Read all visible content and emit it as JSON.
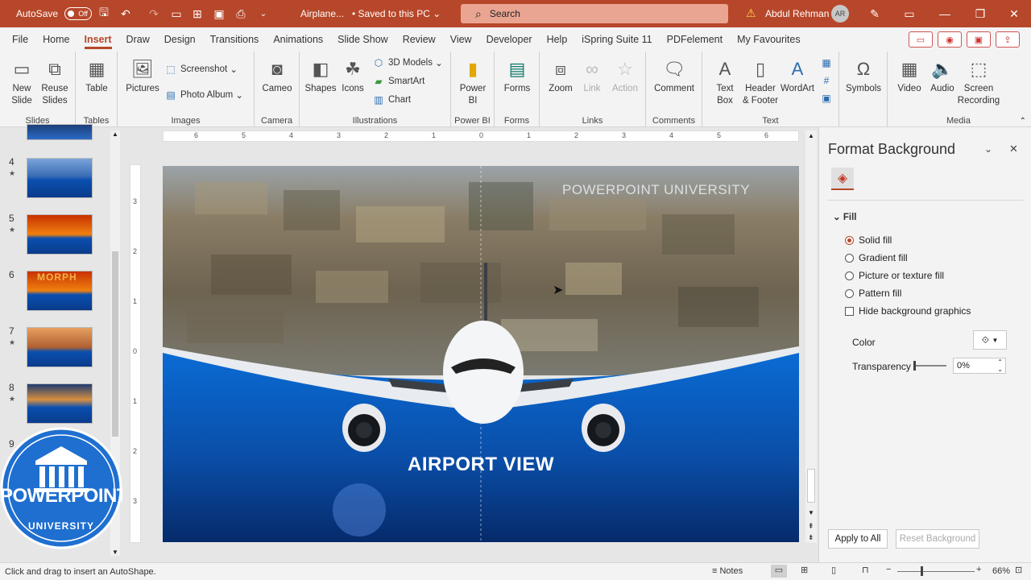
{
  "titlebar": {
    "autosave_label": "AutoSave",
    "autosave_state": "Off",
    "doc_name": "Airplane...",
    "save_status": "• Saved to this PC",
    "search_placeholder": "Search",
    "user_name": "Abdul Rehman",
    "user_initials": "AR"
  },
  "tabs": [
    "File",
    "Home",
    "Insert",
    "Draw",
    "Design",
    "Transitions",
    "Animations",
    "Slide Show",
    "Review",
    "View",
    "Developer",
    "Help",
    "iSpring Suite 11",
    "PDFelement",
    "My Favourites"
  ],
  "active_tab": "Insert",
  "ribbon": {
    "slides": {
      "label": "Slides",
      "new_slide": "New Slide",
      "reuse": "Reuse Slides"
    },
    "tables": {
      "label": "Tables",
      "table": "Table"
    },
    "images": {
      "label": "Images",
      "pictures": "Pictures",
      "screenshot": "Screenshot",
      "photo_album": "Photo Album"
    },
    "camera": {
      "label": "Camera",
      "cameo": "Cameo"
    },
    "illustrations": {
      "label": "Illustrations",
      "shapes": "Shapes",
      "icons": "Icons",
      "models": "3D Models",
      "smartart": "SmartArt",
      "chart": "Chart"
    },
    "powerbi": {
      "label": "Power BI",
      "powerbi": "Power BI"
    },
    "forms": {
      "label": "Forms",
      "forms": "Forms"
    },
    "links": {
      "label": "Links",
      "zoom": "Zoom",
      "link": "Link",
      "action": "Action"
    },
    "comments": {
      "label": "Comments",
      "comment": "Comment"
    },
    "text": {
      "label": "Text",
      "textbox": "Text Box",
      "header": "Header & Footer",
      "wordart": "WordArt"
    },
    "symbols": {
      "symbols": "Symbols"
    },
    "media": {
      "label": "Media",
      "video": "Video",
      "audio": "Audio",
      "screenrec": "Screen Recording"
    }
  },
  "thumbnails": [
    {
      "num": "4",
      "star": "★"
    },
    {
      "num": "5",
      "star": "★"
    },
    {
      "num": "6",
      "star": ""
    },
    {
      "num": "7",
      "star": "★"
    },
    {
      "num": "8",
      "star": "★"
    },
    {
      "num": "9",
      "star": ""
    }
  ],
  "thumb_texts": {
    "t6": "MORPH"
  },
  "logo": {
    "top": "POWERPOINT",
    "bottom": "UNIVERSITY"
  },
  "ruler": {
    "h": [
      "6",
      "5",
      "4",
      "3",
      "2",
      "1",
      "0",
      "1",
      "2",
      "3",
      "4",
      "5",
      "6"
    ],
    "v": [
      "3",
      "2",
      "1",
      "0",
      "1",
      "2",
      "3"
    ]
  },
  "slide": {
    "watermark": "POWERPOINT UNIVERSITY",
    "headline": "AIRPORT VIEW"
  },
  "pane": {
    "title": "Format Background",
    "section": "Fill",
    "options": [
      "Solid fill",
      "Gradient fill",
      "Picture or texture fill",
      "Pattern fill"
    ],
    "selected": "Solid fill",
    "hide_bg": "Hide background graphics",
    "color_label": "Color",
    "transparency_label": "Transparency",
    "transparency_value": "0%",
    "apply_all": "Apply to All",
    "reset": "Reset Background"
  },
  "status": {
    "hint": "Click and drag to insert an AutoShape.",
    "notes": "Notes",
    "zoom": "66%"
  },
  "colors": {
    "accent": "#b7472a",
    "slide_blue": "#0a63c4"
  }
}
